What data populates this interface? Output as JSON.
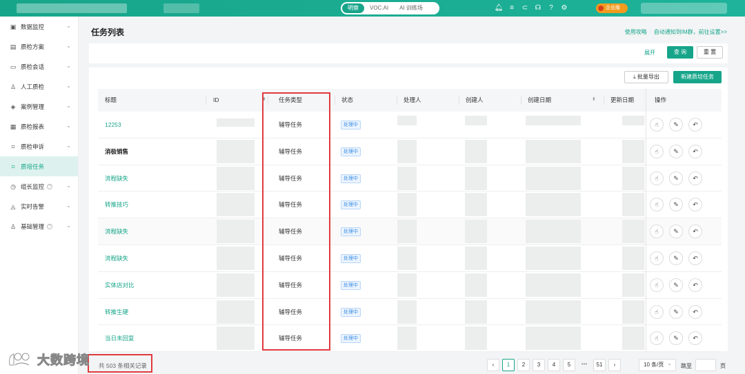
{
  "topbar": {
    "segments": [
      {
        "label": "明察",
        "active": true
      },
      {
        "label": "VOC.AI",
        "active": false
      },
      {
        "label": "AI 训练场",
        "active": false
      }
    ],
    "enterprise_badge": "企业版",
    "icons": [
      "bell-icon",
      "list-icon",
      "link-icon",
      "headset-icon",
      "help-icon",
      "settings-icon"
    ]
  },
  "sidebar": {
    "items": [
      {
        "label": "数据监控",
        "icon": "monitor-icon",
        "active": false,
        "chevron": true
      },
      {
        "label": "质检方案",
        "icon": "plan-icon",
        "active": false,
        "chevron": true
      },
      {
        "label": "质检会话",
        "icon": "chat-icon",
        "active": false,
        "chevron": true
      },
      {
        "label": "人工质检",
        "icon": "user-check-icon",
        "active": false,
        "chevron": true
      },
      {
        "label": "案例管理",
        "icon": "layers-icon",
        "active": false,
        "chevron": true
      },
      {
        "label": "质检报表",
        "icon": "report-icon",
        "active": false,
        "chevron": true
      },
      {
        "label": "质检申诉",
        "icon": "appeal-icon",
        "active": false,
        "chevron": true
      },
      {
        "label": "质培任务",
        "icon": "task-icon",
        "active": true,
        "chevron": false
      },
      {
        "label": "组长监控",
        "icon": "clock-icon",
        "active": false,
        "chevron": true,
        "help": true
      },
      {
        "label": "实时告警",
        "icon": "alarm-icon",
        "active": false,
        "chevron": true
      },
      {
        "label": "基础管理",
        "icon": "admin-icon",
        "active": false,
        "chevron": true,
        "help": true
      }
    ]
  },
  "page": {
    "title": "任务列表",
    "link_guide": "使用攻略",
    "link_notify": "自动通知到IM群，前往设置>>"
  },
  "filter": {
    "expand": "展开",
    "query": "查 询",
    "reset": "重 置"
  },
  "toolbar": {
    "export": "批量导出",
    "new_task": "新建质培任务"
  },
  "table": {
    "columns": [
      "标题",
      "ID",
      "任务类型",
      "状态",
      "处理人",
      "创建人",
      "创建日期",
      "更新日期",
      "操作"
    ],
    "rows": [
      {
        "title": "12253",
        "bold": false,
        "type": "辅导任务",
        "status": "处理中"
      },
      {
        "title": "消极销售",
        "bold": true,
        "type": "辅导任务",
        "status": "处理中"
      },
      {
        "title": "流程缺失",
        "bold": false,
        "type": "辅导任务",
        "status": "处理中"
      },
      {
        "title": "转推技巧",
        "bold": false,
        "type": "辅导任务",
        "status": "处理中"
      },
      {
        "title": "流程缺失",
        "bold": false,
        "type": "辅导任务",
        "status": "处理中"
      },
      {
        "title": "流程缺失",
        "bold": false,
        "type": "辅导任务",
        "status": "处理中"
      },
      {
        "title": "实体店对比",
        "bold": false,
        "type": "辅导任务",
        "status": "处理中"
      },
      {
        "title": "转推生硬",
        "bold": false,
        "type": "辅导任务",
        "status": "处理中"
      },
      {
        "title": "当日未回复",
        "bold": false,
        "type": "辅导任务",
        "status": "处理中"
      }
    ]
  },
  "footer": {
    "total": "共 503 条相关记录",
    "pages": [
      "1",
      "2",
      "3",
      "4",
      "5",
      "•••",
      "51"
    ],
    "current_page": "1",
    "page_size": "10 条/页",
    "jump_label": "跳至",
    "jump_unit": "页"
  },
  "watermark": {
    "text": "大数跨境"
  },
  "colors": {
    "primary": "#17a58a",
    "highlight": "#e0393e",
    "tag_blue": "#3a8ee6",
    "badge_orange": "#f29b1d"
  }
}
